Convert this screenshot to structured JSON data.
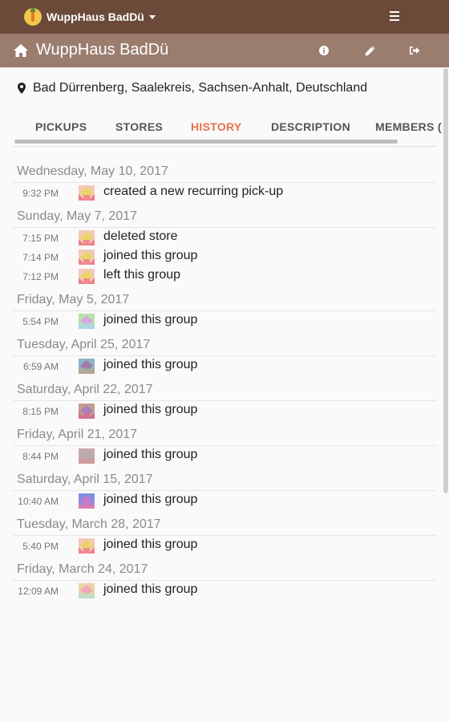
{
  "app": {
    "brand": "WuppHaus BadDü"
  },
  "group": {
    "title": "WuppHaus BadDü",
    "location": "Bad Dürrenberg, Saalekreis, Sachsen-Anhalt, Deutschland"
  },
  "tabs": [
    {
      "label": "PICKUPS",
      "active": false
    },
    {
      "label": "STORES",
      "active": false
    },
    {
      "label": "HISTORY",
      "active": true
    },
    {
      "label": "DESCRIPTION",
      "active": false
    },
    {
      "label": "MEMBERS (",
      "active": false
    }
  ],
  "history": [
    {
      "date": "Wednesday, May 10, 2017",
      "entries": [
        {
          "time": "9:32 PM",
          "text": "created a new recurring pick-up",
          "avatar": [
            "#f4c9b8",
            "#e9d46a",
            "#ee7f8a"
          ]
        }
      ]
    },
    {
      "date": "Sunday, May 7, 2017",
      "entries": [
        {
          "time": "7:15 PM",
          "text": "deleted store",
          "avatar": [
            "#f4c9b8",
            "#e9d46a",
            "#ee7f8a"
          ]
        },
        {
          "time": "7:14 PM",
          "text": "joined this group",
          "avatar": [
            "#f4c9b8",
            "#e9d46a",
            "#ee7f8a"
          ]
        },
        {
          "time": "7:12 PM",
          "text": "left this group",
          "avatar": [
            "#f4c9b8",
            "#e9d46a",
            "#ee7f8a"
          ]
        }
      ]
    },
    {
      "date": "Friday, May 5, 2017",
      "entries": [
        {
          "time": "5:54 PM",
          "text": "joined this group",
          "avatar": [
            "#b9e3a8",
            "#d8a7e0",
            "#a8d6e8"
          ]
        }
      ]
    },
    {
      "date": "Tuesday, April 25, 2017",
      "entries": [
        {
          "time": "6:59 AM",
          "text": "joined this group",
          "avatar": [
            "#8fb3c9",
            "#9d7fa8",
            "#b6a58c"
          ]
        }
      ]
    },
    {
      "date": "Saturday, April 22, 2017",
      "entries": [
        {
          "time": "8:15 PM",
          "text": "joined this group",
          "avatar": [
            "#c59b8a",
            "#a77fc0",
            "#d26e8e"
          ]
        }
      ]
    },
    {
      "date": "Friday, April 21, 2017",
      "entries": [
        {
          "time": "8:44 PM",
          "text": "joined this group",
          "avatar": [
            "#c8a8a8",
            "#b0b0b0",
            "#cf9a9a"
          ]
        }
      ]
    },
    {
      "date": "Saturday, April 15, 2017",
      "entries": [
        {
          "time": "10:40 AM",
          "text": "joined this group",
          "avatar": [
            "#7f8fe0",
            "#c07ad0",
            "#e07ab0"
          ]
        }
      ]
    },
    {
      "date": "Tuesday, March 28, 2017",
      "entries": [
        {
          "time": "5:40 PM",
          "text": "joined this group",
          "avatar": [
            "#f4c9b8",
            "#e9d46a",
            "#ee7f8a"
          ]
        }
      ]
    },
    {
      "date": "Friday, March 24, 2017",
      "entries": [
        {
          "time": "12:09 AM",
          "text": "joined this group",
          "avatar": [
            "#e9d4a8",
            "#f0a8b8",
            "#b8e0c8"
          ]
        }
      ]
    }
  ],
  "icons": {
    "home": "home-icon",
    "info": "info-icon",
    "edit": "pencil-icon",
    "leave": "sign-out-icon",
    "location": "map-pin-icon",
    "menu": "hamburger-menu-icon"
  },
  "colors": {
    "topbar": "#6b4a3a",
    "groupbar": "#9b7d6e",
    "accent": "#e8704a"
  }
}
